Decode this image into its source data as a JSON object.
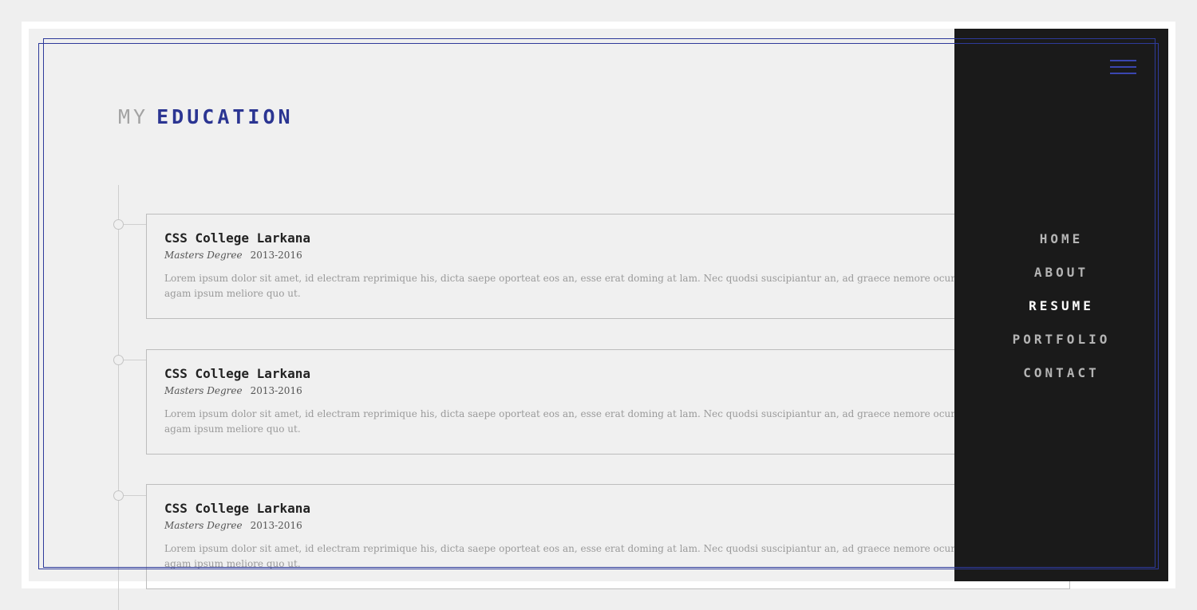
{
  "section": {
    "title_light": "MY",
    "title_strong": "EDUCATION"
  },
  "education": [
    {
      "school": "CSS College Larkana",
      "degree": "Masters Degree",
      "years": "2013-2016",
      "description": "Lorem ipsum dolor sit amet, id electram reprimique his, dicta saepe oporteat eos an, esse erat doming at lam. Nec quodsi suscipiantur an, ad graece nemore ocurreret lam agam ipsum meliore quo ut."
    },
    {
      "school": "CSS College Larkana",
      "degree": "Masters Degree",
      "years": "2013-2016",
      "description": "Lorem ipsum dolor sit amet, id electram reprimique his, dicta saepe oporteat eos an, esse erat doming at lam. Nec quodsi suscipiantur an, ad graece nemore ocurreret lam agam ipsum meliore quo ut."
    },
    {
      "school": "CSS College Larkana",
      "degree": "Masters Degree",
      "years": "2013-2016",
      "description": "Lorem ipsum dolor sit amet, id electram reprimique his, dicta saepe oporteat eos an, esse erat doming at lam. Nec quodsi suscipiantur an, ad graece nemore ocurreret lam agam ipsum meliore quo ut."
    }
  ],
  "nav": {
    "menu_icon": "hamburger-menu-icon",
    "items": [
      {
        "label": "HOME",
        "active": false
      },
      {
        "label": "ABOUT",
        "active": false
      },
      {
        "label": "RESUME",
        "active": true
      },
      {
        "label": "PORTFOLIO",
        "active": false
      },
      {
        "label": "CONTACT",
        "active": false
      }
    ]
  },
  "colors": {
    "accent": "#2b3592",
    "panel_bg": "#1a1a1a",
    "page_bg": "#f0f0f0",
    "nav_active": "#ffffff",
    "nav_inactive": "#b4b4b4"
  }
}
